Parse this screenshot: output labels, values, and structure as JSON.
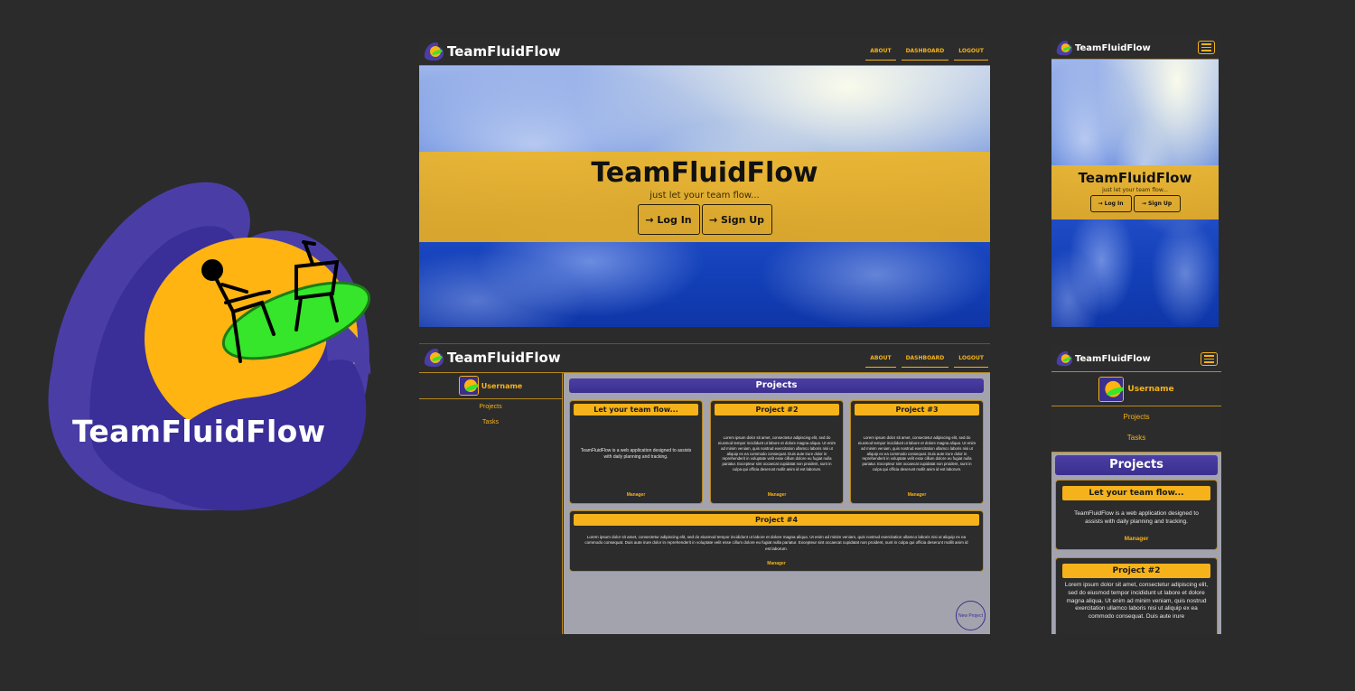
{
  "logo": {
    "wordmark": "TeamFluidFlow"
  },
  "nav": {
    "brand": "TeamFluidFlow",
    "links": [
      "ABOUT",
      "DASHBOARD",
      "LOGOUT"
    ]
  },
  "hero": {
    "title": "TeamFluidFlow",
    "tagline": "just let your team flow...",
    "login_label": "→ Log In",
    "signup_label": "→ Sign Up"
  },
  "dashboard": {
    "username": "Username",
    "side_links": [
      "Projects",
      "Tasks"
    ],
    "projects_heading": "Projects",
    "new_project_label": "New Project",
    "projects": [
      {
        "title": "Let your team flow...",
        "body": "TeamFluidFlow is a web application designed to assists with daily planning and tracking.",
        "manager": "Manager"
      },
      {
        "title": "Project #2",
        "body": "Lorem ipsum dolor sit amet, consectetur adipiscing elit, sed do eiusmod tempor incididunt ut labore et dolore magna aliqua. Ut enim ad minim veniam, quis nostrud exercitation ullamco laboris nisi ut aliquip ex ea commodo consequat. Duis aute irure dolor in reprehenderit in voluptate velit esse cillum dolore eu fugiat nulla pariatur. Excepteur sint occaecat cupidatat non proident, sunt in culpa qui officia deserunt mollit anim id est laborum.",
        "manager": "Manager"
      },
      {
        "title": "Project #3",
        "body": "Lorem ipsum dolor sit amet, consectetur adipiscing elit, sed do eiusmod tempor incididunt ut labore et dolore magna aliqua. Ut enim ad minim veniam, quis nostrud exercitation ullamco laboris nisi ut aliquip ex ea commodo consequat. Duis aute irure dolor in reprehenderit in voluptate velit esse cillum dolore eu fugiat nulla pariatur. Excepteur sint occaecat cupidatat non proident, sunt in culpa qui officia deserunt mollit anim id est laborum.",
        "manager": "Manager"
      },
      {
        "title": "Project #4",
        "body": "Lorem ipsum dolor sit amet, consectetur adipiscing elit, sed do eiusmod tempor incididunt ut labore et dolore magna aliqua. Ut enim ad minim veniam, quis nostrud exercitation ullamco laboris nisi ut aliquip ex ea commodo consequat. Duis aute irure dolor in reprehenderit in voluptate velit esse cillum dolore eu fugiat nulla pariatur. Excepteur sint occaecat cupidatat non proident, sunt in culpa qui officia deserunt mollit anim id est laborum.",
        "manager": "Manager"
      }
    ],
    "mobile_project2_body": "Lorem ipsum dolor sit amet, consectetur adipiscing elit, sed do eiusmod tempor incididunt ut labore et dolore magna aliqua. Ut enim ad minim veniam, quis nostrud exercitation ullamco laboris nisi ut aliquip ex ea commodo consequat. Duis aute irure"
  },
  "colors": {
    "background": "#2b2b2b",
    "accent": "#f5b21a",
    "purple": "#3b2f8c",
    "panel": "#2c2c2c"
  }
}
